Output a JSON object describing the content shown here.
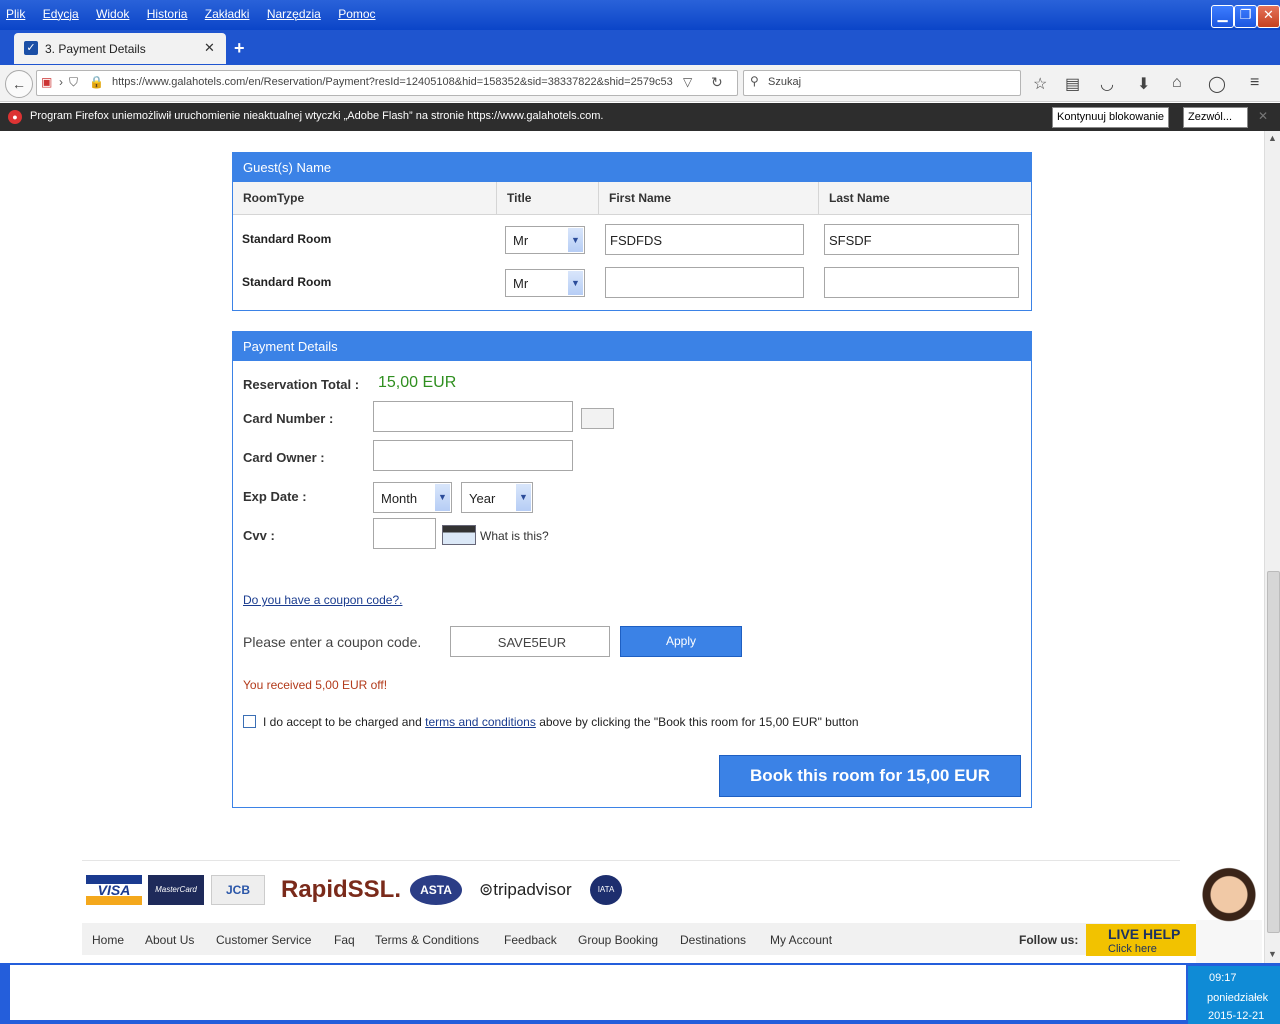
{
  "browser": {
    "menu": [
      "Plik",
      "Edycja",
      "Widok",
      "Historia",
      "Zakładki",
      "Narzędzia",
      "Pomoc"
    ],
    "tab_title": "3. Payment Details",
    "url": "https://www.galahotels.com/en/Reservation/Payment?resId=12405108&hid=158352&sid=38337822&shid=2579c53",
    "search_placeholder": "Szukaj",
    "notification": "Program Firefox uniemożliwił uruchomienie nieaktualnej wtyczki „Adobe Flash” na stronie https://www.galahotels.com.",
    "notif_btn_continue": "Kontynuuj blokowanie",
    "notif_btn_allow": "Zezwól..."
  },
  "guests": {
    "heading": "Guest(s) Name",
    "columns": [
      "RoomType",
      "Title",
      "First Name",
      "Last Name"
    ],
    "rows": [
      {
        "room": "Standard Room",
        "title": "Mr",
        "first": "FSDFDS",
        "last": "SFSDF"
      },
      {
        "room": "Standard Room",
        "title": "Mr",
        "first": "",
        "last": ""
      }
    ]
  },
  "payment": {
    "heading": "Payment Details",
    "total_label": "Reservation Total :",
    "total_value": "15,00 EUR",
    "card_number_label": "Card Number :",
    "card_owner_label": "Card Owner :",
    "exp_label": "Exp Date :",
    "month": "Month",
    "year": "Year",
    "cvv_label": "Cvv :",
    "what_is_this": "What is this?",
    "coupon_link": "Do you have a coupon code?.",
    "coupon_prompt": "Please enter a coupon code.",
    "coupon_value": "SAVE5EUR",
    "apply": "Apply",
    "discount_msg": "You received 5,00 EUR off!",
    "terms_pre": "I do accept to be charged and ",
    "terms_link": "terms and conditions",
    "terms_post": " above by clicking the \"Book this room for 15,00 EUR\" button",
    "book_button": "Book this room for 15,00 EUR"
  },
  "footer": {
    "logos": [
      "VISA",
      "MasterCard",
      "JCB",
      "RapidSSL.",
      "ASTA",
      "tripadvisor",
      "IATA"
    ],
    "nav": [
      "Home",
      "About Us",
      "Customer Service",
      "Faq",
      "Terms & Conditions",
      "Feedback",
      "Group Booking",
      "Destinations",
      "My Account"
    ],
    "follow": "Follow us:",
    "live_help": "LIVE HELP",
    "live_help_sub": "Click here"
  },
  "taskbar": {
    "time": "09:17",
    "day": "poniedziałek",
    "date": "2015-12-21"
  },
  "colors": {
    "accent": "#3b82e6",
    "total_green": "#2f8f1f",
    "discount_red": "#b23a1a"
  }
}
